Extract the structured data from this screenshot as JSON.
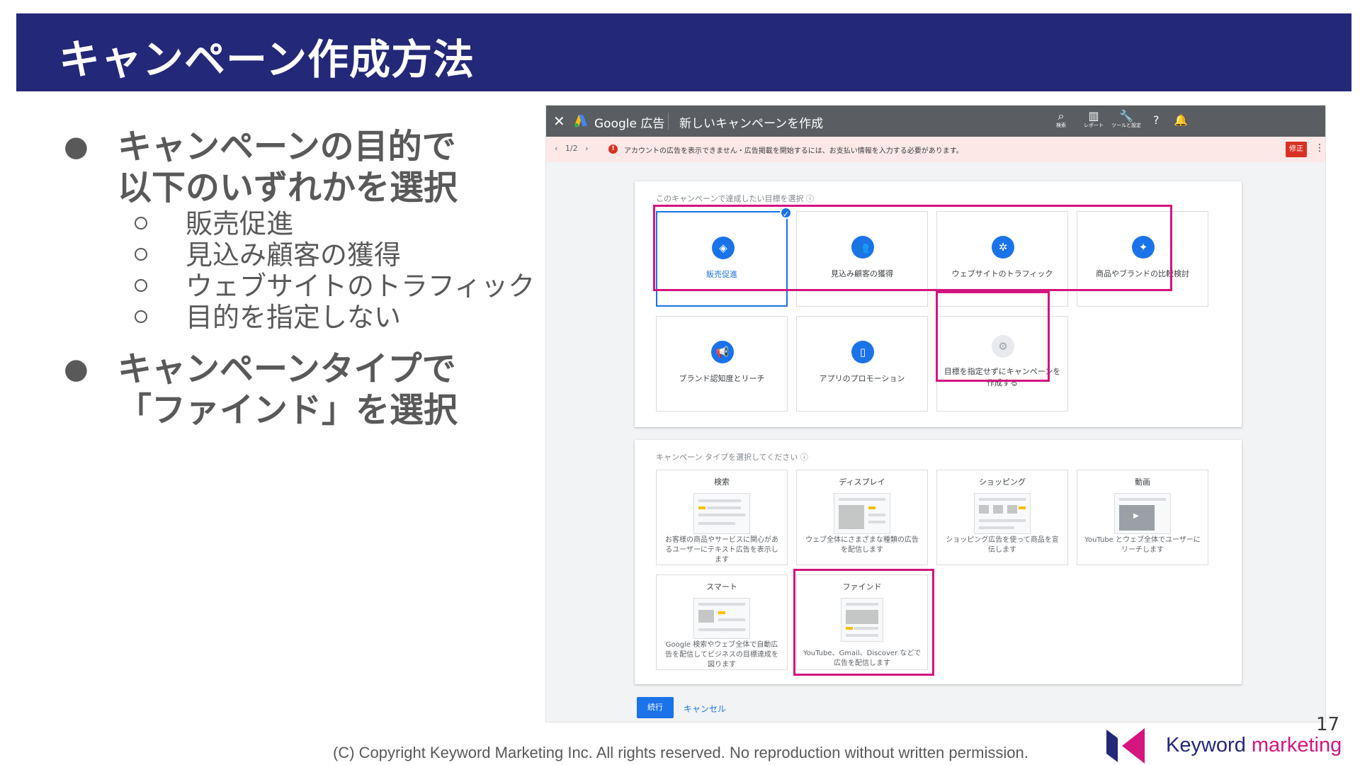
{
  "slide": {
    "title": "キャンペーン作成方法",
    "page_number": "17",
    "copyright": "(C) Copyright Keyword Marketing Inc. All rights reserved. No reproduction without written permission.",
    "logo_word1": "Keyword",
    "logo_word2": "marketing"
  },
  "bullets": {
    "b1_line1": "キャンペーンの目的で",
    "b1_line2": "以下のいずれかを選択",
    "sub": [
      "販売促進",
      "見込み顧客の獲得",
      "ウェブサイトのトラフィック",
      "目的を指定しない"
    ],
    "b2_line1": "キャンペーンタイプで",
    "b2_line2": "「ファインド」を選択"
  },
  "screenshot": {
    "topbar": {
      "brand": "Google 広告",
      "page_title": "新しいキャンペーンを作成",
      "tools": [
        {
          "icon": "search-icon",
          "label": "検索"
        },
        {
          "icon": "reports-icon",
          "label": "レポート"
        },
        {
          "icon": "wrench-icon",
          "label": "ツールと設定"
        }
      ]
    },
    "alert": {
      "nav": "1/2",
      "text": "アカウントの広告を表示できません・広告掲載を開始するには、お支払い情報を入力する必要があります。",
      "button": "修正"
    },
    "goals": {
      "title": "このキャンペーンで達成したい目標を選択 ⓘ",
      "items": [
        {
          "label": "販売促進",
          "icon": "tag-icon",
          "selected": true
        },
        {
          "label": "見込み顧客の獲得",
          "icon": "people-icon"
        },
        {
          "label": "ウェブサイトのトラフィック",
          "icon": "cursor-click-icon"
        },
        {
          "label": "商品やブランドの比較検討",
          "icon": "sparkle-icon"
        },
        {
          "label": "ブランド認知度とリーチ",
          "icon": "megaphone-icon"
        },
        {
          "label": "アプリのプロモーション",
          "icon": "phone-icon"
        },
        {
          "label": "目標を指定せずにキャンペーンを作成する",
          "icon": "gear-icon"
        }
      ]
    },
    "types": {
      "title": "キャンペーン タイプを選択してください ⓘ",
      "items": [
        {
          "title": "検索",
          "desc": "お客様の商品やサービスに関心があるユーザーにテキスト広告を表示します"
        },
        {
          "title": "ディスプレイ",
          "desc": "ウェブ全体にさまざまな種類の広告を配信します"
        },
        {
          "title": "ショッピング",
          "desc": "ショッピング広告を使って商品を宣伝します"
        },
        {
          "title": "動画",
          "desc": "YouTube とウェブ全体でユーザーにリーチします"
        },
        {
          "title": "スマート",
          "desc": "Google 検索やウェブ全体で自動広告を配信してビジネスの目標達成を図ります"
        },
        {
          "title": "ファインド",
          "desc": "YouTube、Gmail、Discover などで広告を配信します"
        }
      ]
    },
    "buttons": {
      "continue": "続行",
      "cancel": "キャンセル"
    }
  }
}
